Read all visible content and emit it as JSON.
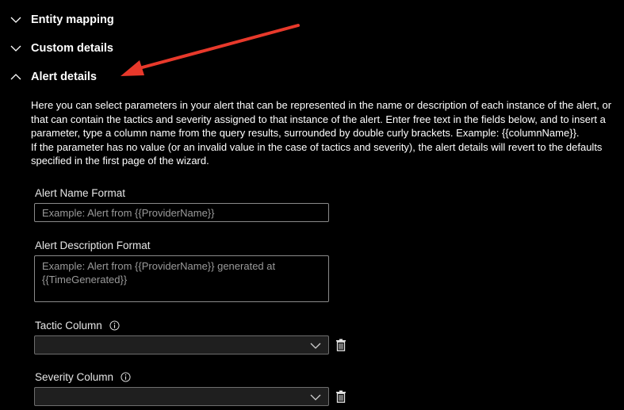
{
  "sections": {
    "entity_mapping": {
      "label": "Entity mapping",
      "expanded": false
    },
    "custom_details": {
      "label": "Custom details",
      "expanded": false
    },
    "alert_details": {
      "label": "Alert details",
      "expanded": true
    }
  },
  "alert_details": {
    "description_line1": "Here you can select parameters in your alert that can be represented in the name or description of each instance of the alert, or that can contain the tactics and severity assigned to that instance of the alert. Enter free text in the fields below, and to insert a parameter, type a column name from the query results, surrounded by double curly brackets. Example: {{columnName}}.",
    "description_line2": "If the parameter has no value (or an invalid value in the case of tactics and severity), the alert details will revert to the defaults specified in the first page of the wizard.",
    "name_format": {
      "label": "Alert Name Format",
      "placeholder": "Example: Alert from {{ProviderName}}",
      "value": ""
    },
    "description_format": {
      "label": "Alert Description Format",
      "placeholder": "Example: Alert from {{ProviderName}} generated at {{TimeGenerated}}",
      "value": ""
    },
    "tactic_column": {
      "label": "Tactic Column",
      "selected": ""
    },
    "severity_column": {
      "label": "Severity Column",
      "selected": ""
    }
  },
  "colors": {
    "background": "#000000",
    "text": "#ffffff",
    "annotation_arrow": "#e8392b"
  }
}
